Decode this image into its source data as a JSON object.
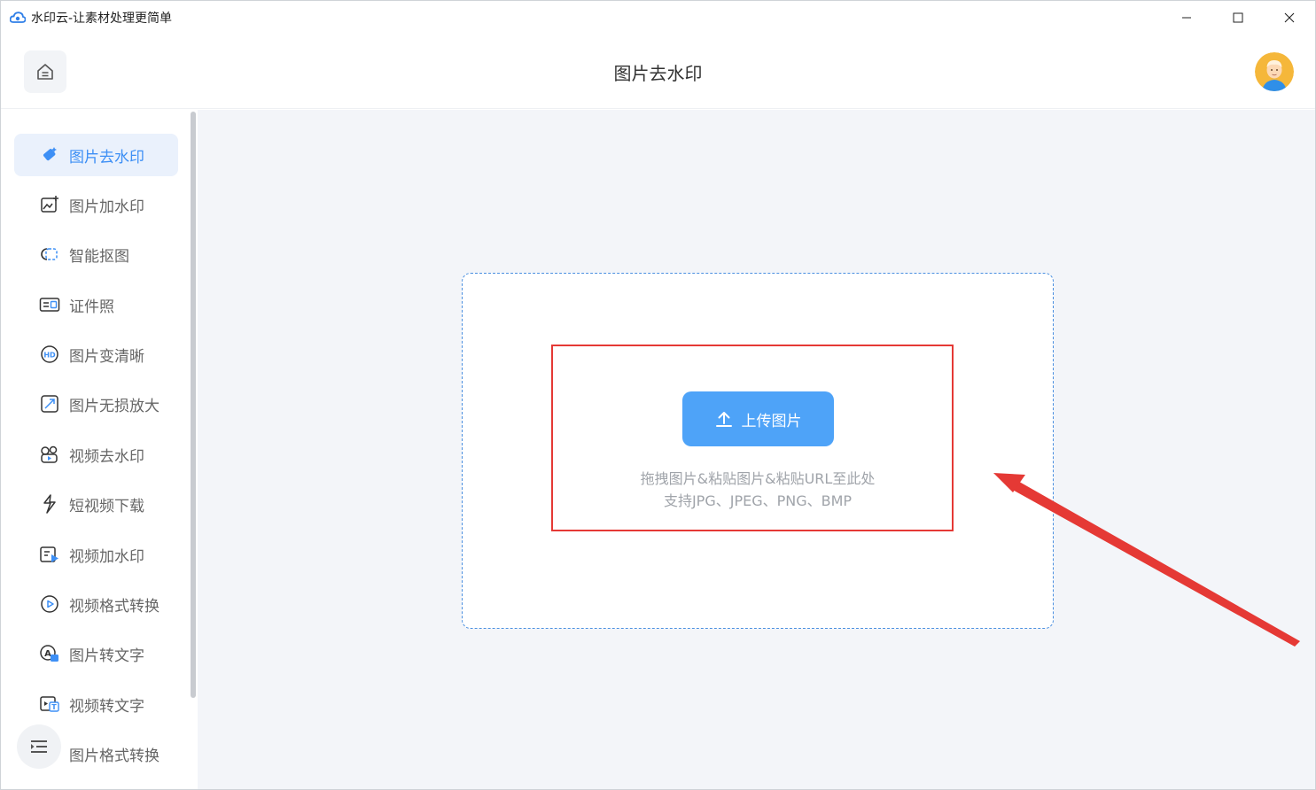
{
  "window": {
    "title": "水印云-让素材处理更简单",
    "controls": [
      "minimize",
      "maximize",
      "close"
    ]
  },
  "header": {
    "title": "图片去水印",
    "home_icon": "home-icon",
    "avatar": "user-avatar"
  },
  "sidebar": {
    "items": [
      {
        "label": "图片去水印",
        "icon": "eraser-icon",
        "active": true
      },
      {
        "label": "图片加水印",
        "icon": "image-add-icon",
        "active": false
      },
      {
        "label": "智能抠图",
        "icon": "cutout-icon",
        "active": false
      },
      {
        "label": "证件照",
        "icon": "id-card-icon",
        "active": false
      },
      {
        "label": "图片变清晰",
        "icon": "hd-icon",
        "active": false
      },
      {
        "label": "图片无损放大",
        "icon": "enlarge-icon",
        "active": false
      },
      {
        "label": "视频去水印",
        "icon": "video-eraser-icon",
        "active": false
      },
      {
        "label": "短视频下载",
        "icon": "download-icon",
        "active": false
      },
      {
        "label": "视频加水印",
        "icon": "video-add-icon",
        "active": false
      },
      {
        "label": "视频格式转换",
        "icon": "play-circle-icon",
        "active": false
      },
      {
        "label": "图片转文字",
        "icon": "image-text-icon",
        "active": false
      },
      {
        "label": "视频转文字",
        "icon": "video-text-icon",
        "active": false
      },
      {
        "label": "图片格式转换",
        "icon": "format-icon",
        "active": false
      }
    ],
    "menu_toggle_icon": "menu-collapse-icon"
  },
  "main": {
    "upload_label": "上传图片",
    "hint_line1": "拖拽图片&粘贴图片&粘贴URL至此处",
    "hint_line2": "支持JPG、JPEG、PNG、BMP"
  },
  "colors": {
    "accent": "#4ea3f8",
    "active_text": "#3d8ff5",
    "active_bg": "#eaf1fc",
    "highlight": "#e53935",
    "main_bg": "#f3f5f9"
  }
}
